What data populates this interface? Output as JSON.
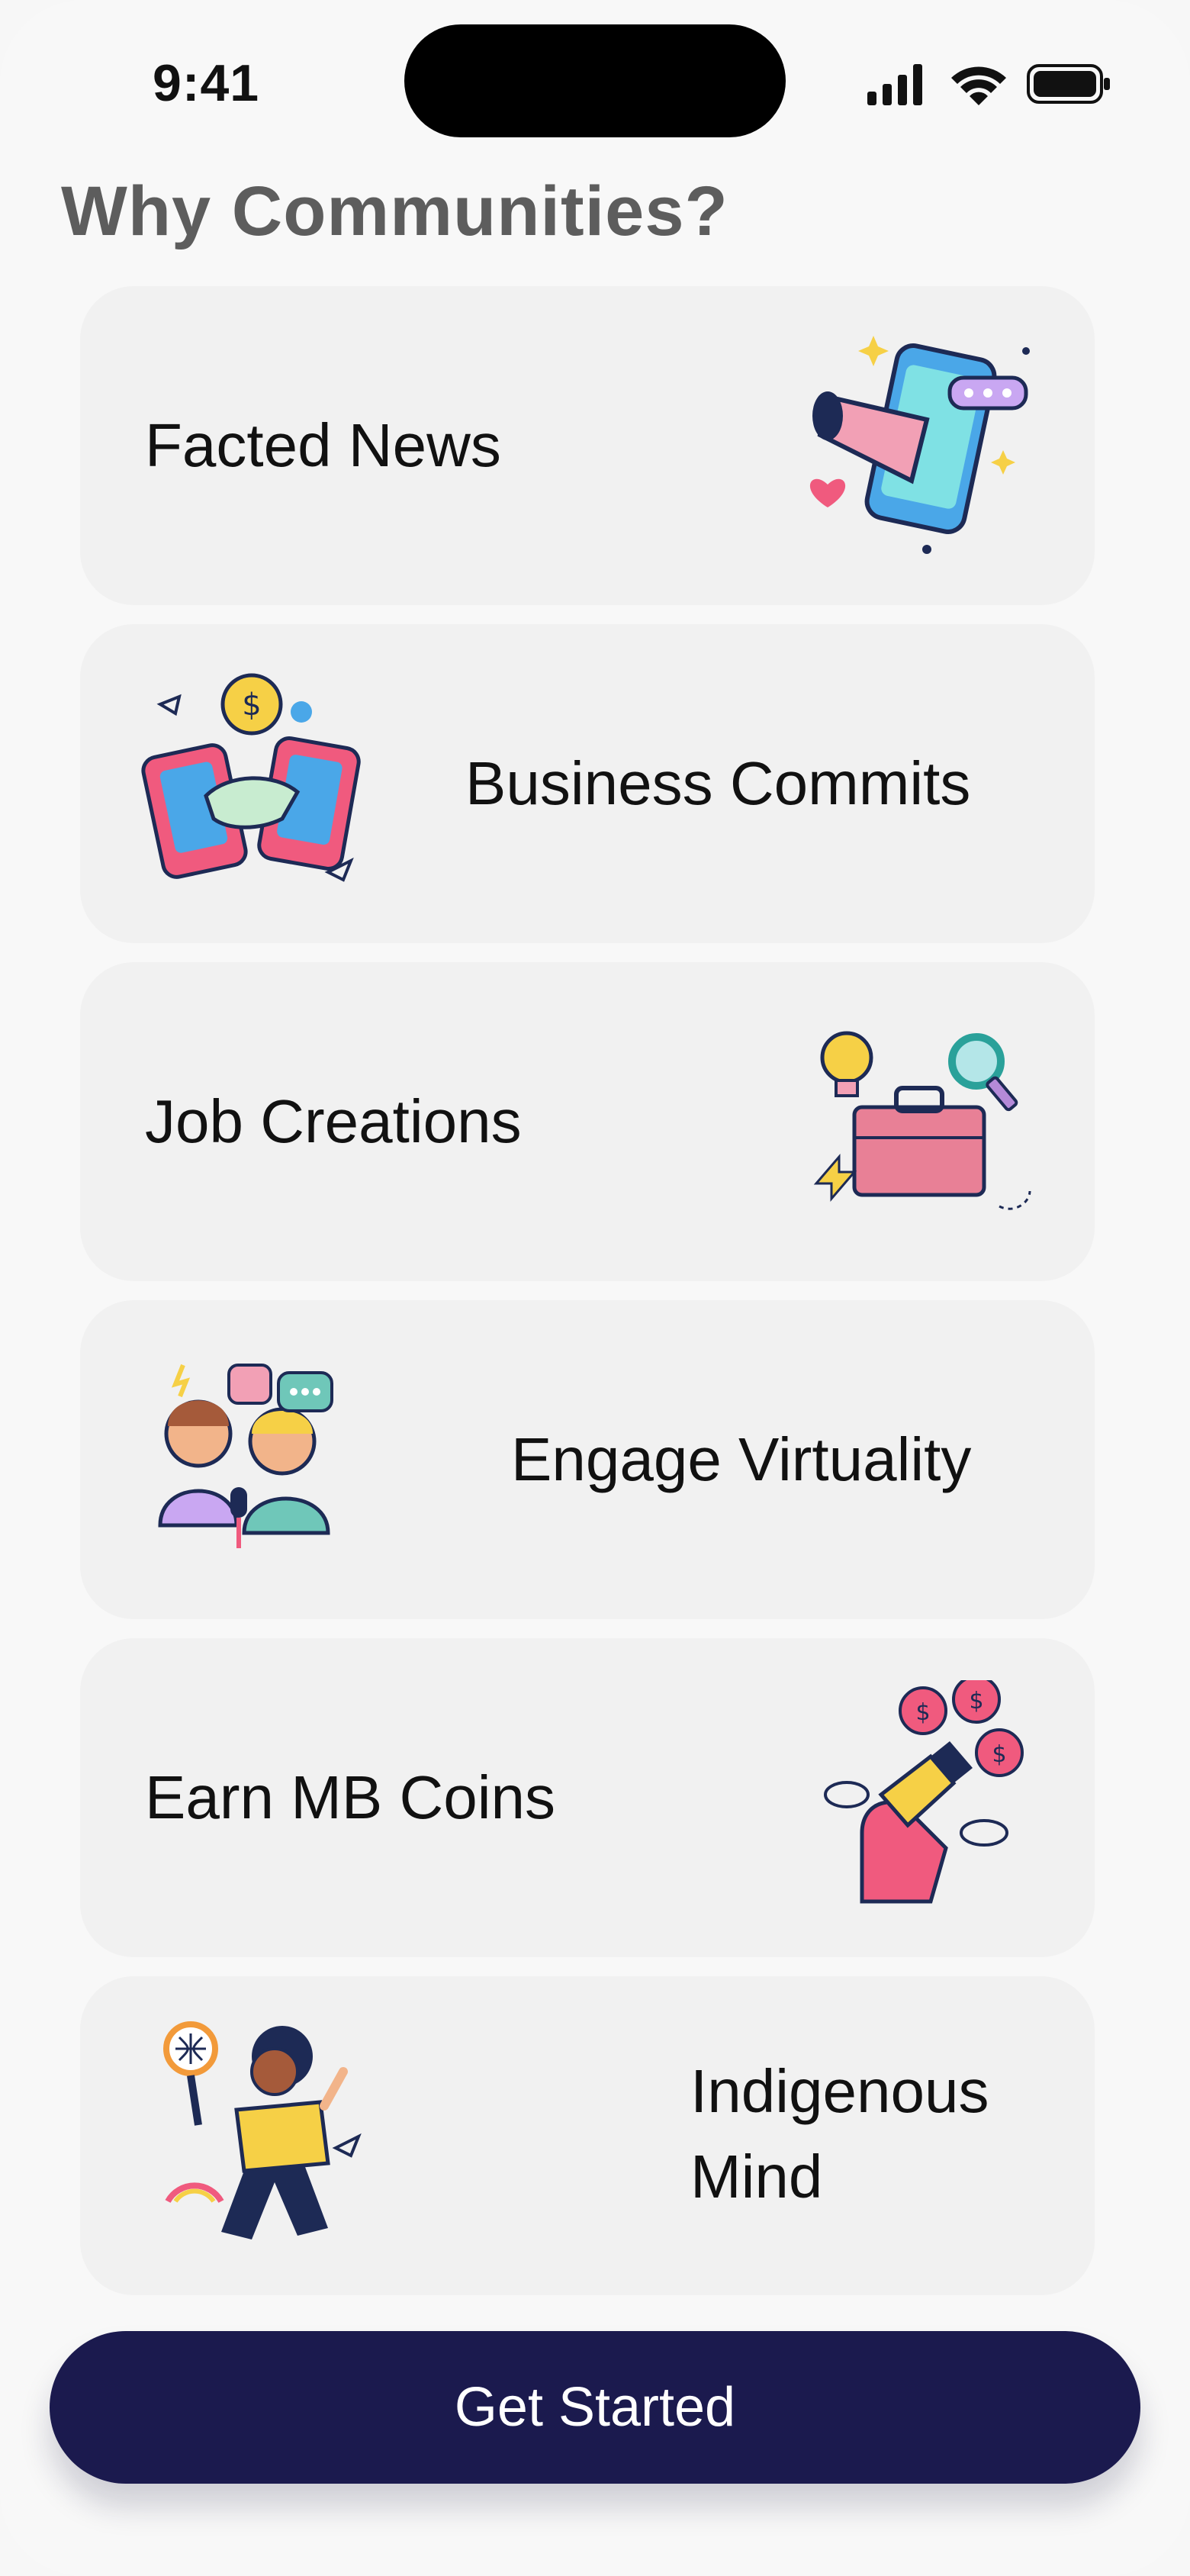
{
  "status_bar": {
    "time": "9:41"
  },
  "heading": "Why Communities?",
  "cards": [
    {
      "label": "Facted News",
      "icon": "megaphone-phone-icon"
    },
    {
      "label": "Business Commits",
      "icon": "handshake-phones-icon"
    },
    {
      "label": "Job Creations",
      "icon": "briefcase-lightbulb-icon"
    },
    {
      "label": "Engage Virtuality",
      "icon": "podcast-people-icon"
    },
    {
      "label": "Earn MB Coins",
      "icon": "coin-magnet-icon"
    },
    {
      "label_line1": "Indigenous",
      "label_line2": "Mind",
      "icon": "globe-explorer-icon"
    }
  ],
  "cta": {
    "label": "Get Started"
  },
  "colors": {
    "cta_bg": "#1b1a4e",
    "card_bg": "#f1f1f1",
    "heading": "#5d5d5d"
  }
}
